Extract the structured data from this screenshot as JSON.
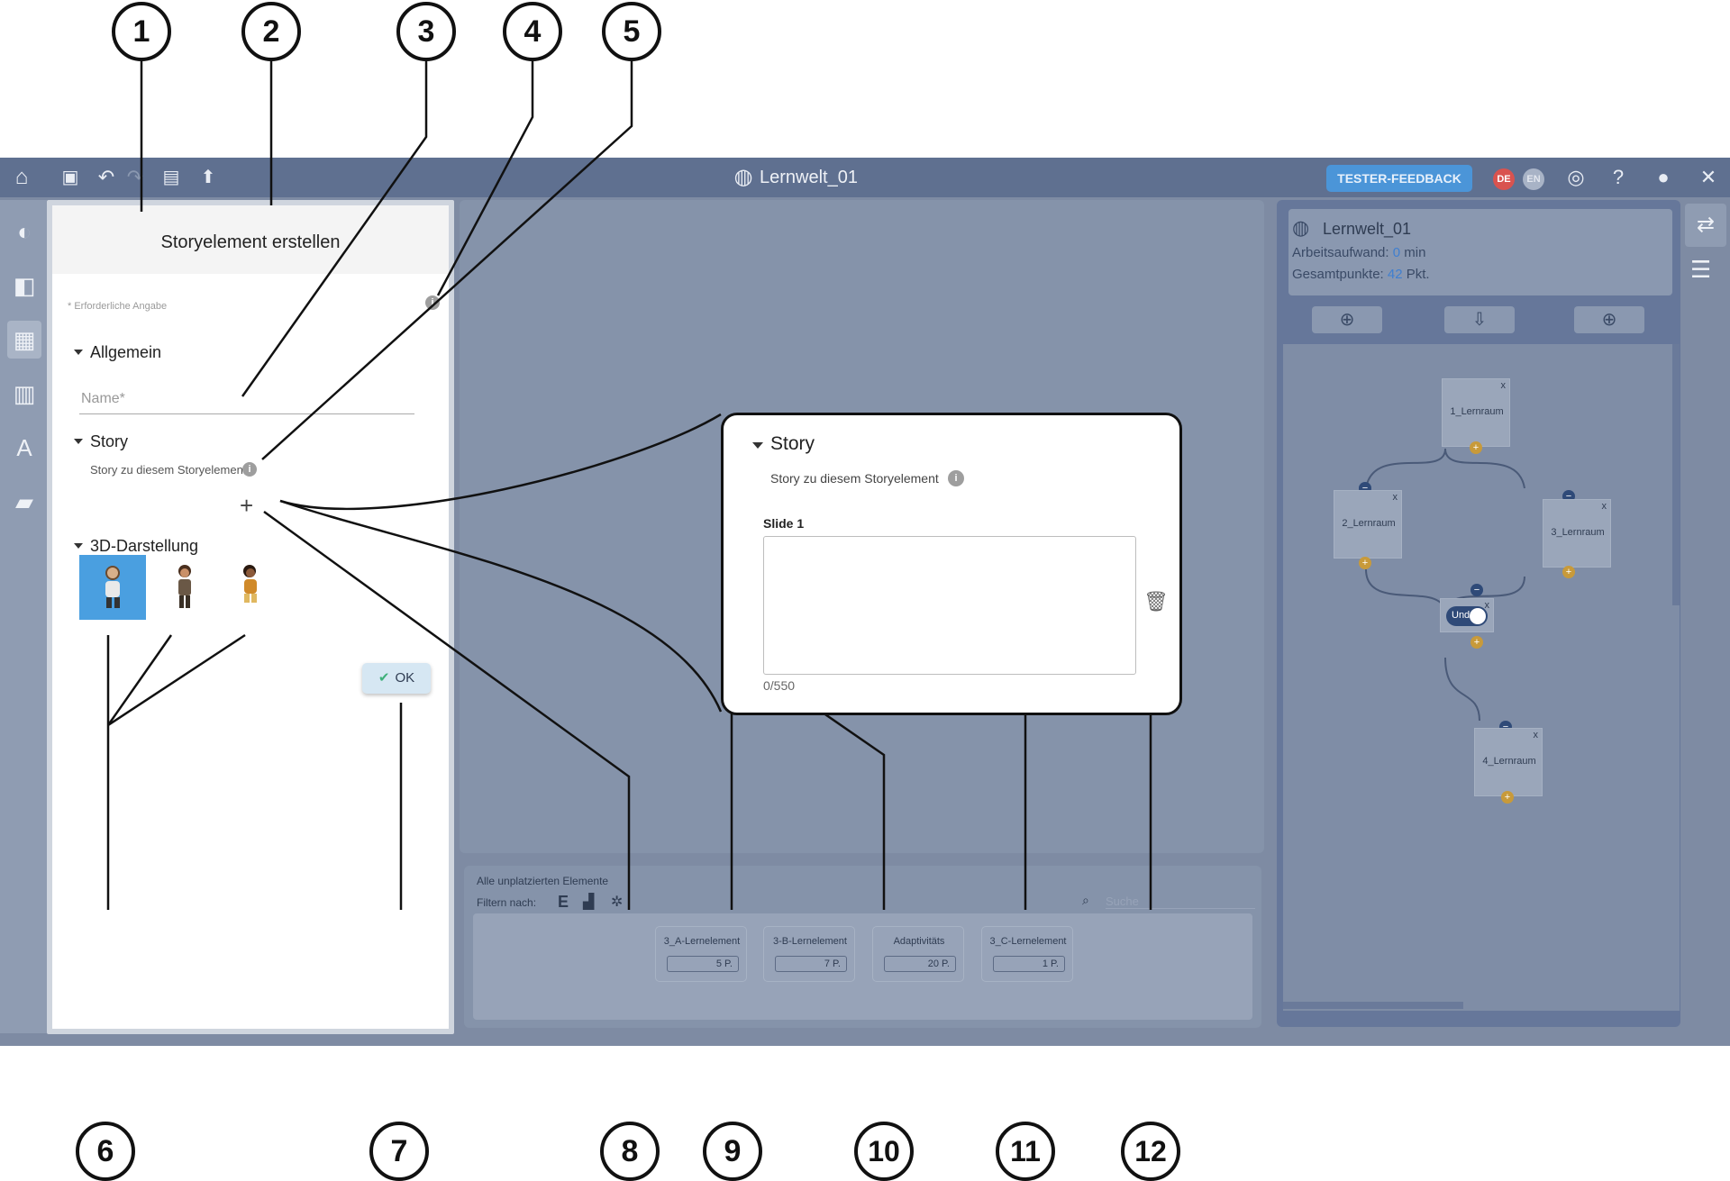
{
  "app": {
    "title": "Lernwelt_01",
    "tester_feedback_label": "TESTER-FEEDBACK",
    "lang_de": "DE",
    "lang_en": "EN"
  },
  "dialog": {
    "title": "Storyelement erstellen",
    "required_note": "* Erforderliche Angabe",
    "general_section": "Allgemein",
    "name_placeholder": "Name*",
    "story_section": "Story",
    "story_hint": "Story zu diesem Storyelement",
    "add_symbol": "+",
    "display_section": "3D-Darstellung",
    "ok_label": "OK",
    "selected_avatar_index": 0
  },
  "zoom": {
    "story_title": "Story",
    "story_hint": "Story zu diesem Storyelement",
    "slide_label": "Slide 1",
    "counter": "0/550"
  },
  "unplaced": {
    "title": "Alle unplatzierten Elemente",
    "filter_label": "Filtern nach:",
    "filter_e": "E",
    "search_placeholder": "Suche",
    "cards": [
      {
        "label": "3_A-Lernelement",
        "points": "5 P."
      },
      {
        "label": "3-B-Lernelement",
        "points": "7 P."
      },
      {
        "label": "Adaptivitäts",
        "points": "20 P."
      },
      {
        "label": "3_C-Lernelement",
        "points": "1 P."
      }
    ]
  },
  "right_panel": {
    "world_name": "Lernwelt_01",
    "effort_label": "Arbeitsaufwand:",
    "effort_value": "0",
    "effort_unit": "min",
    "points_label": "Gesamtpunkte:",
    "points_value": "42",
    "points_unit": "Pkt.",
    "nodes": [
      "1_Lernraum",
      "2_Lernraum",
      "3_Lernraum",
      "4_Lernraum"
    ],
    "and_label": "Und"
  },
  "callouts": [
    "1",
    "2",
    "3",
    "4",
    "5",
    "6",
    "7",
    "8",
    "9",
    "10",
    "11",
    "12"
  ],
  "icons": [
    "home-icon",
    "save-icon",
    "undo-icon",
    "redo-icon",
    "archive-icon",
    "upload-icon",
    "globe-icon",
    "target-icon",
    "help-icon",
    "user-icon",
    "close-icon",
    "trash-icon",
    "check-icon",
    "info-icon",
    "search-icon"
  ]
}
